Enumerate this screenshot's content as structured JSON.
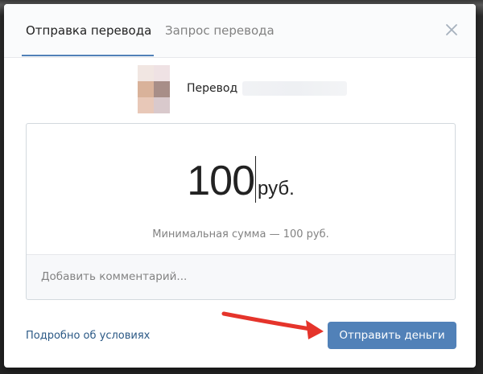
{
  "tabs": [
    {
      "label": "Отправка перевода",
      "active": true
    },
    {
      "label": "Запрос перевода",
      "active": false
    }
  ],
  "close_icon": "close-icon",
  "recipient": {
    "label": "Перевод"
  },
  "amount": {
    "value": "100",
    "currency": "руб.",
    "min_hint": "Минимальная сумма — 100 руб."
  },
  "comment": {
    "placeholder": "Добавить комментарий...",
    "value": ""
  },
  "footer": {
    "terms_link": "Подробно об условиях",
    "send_button": "Отправить деньги"
  },
  "colors": {
    "accent": "#5181b8",
    "link": "#2a5885",
    "arrow": "#e5342b"
  }
}
